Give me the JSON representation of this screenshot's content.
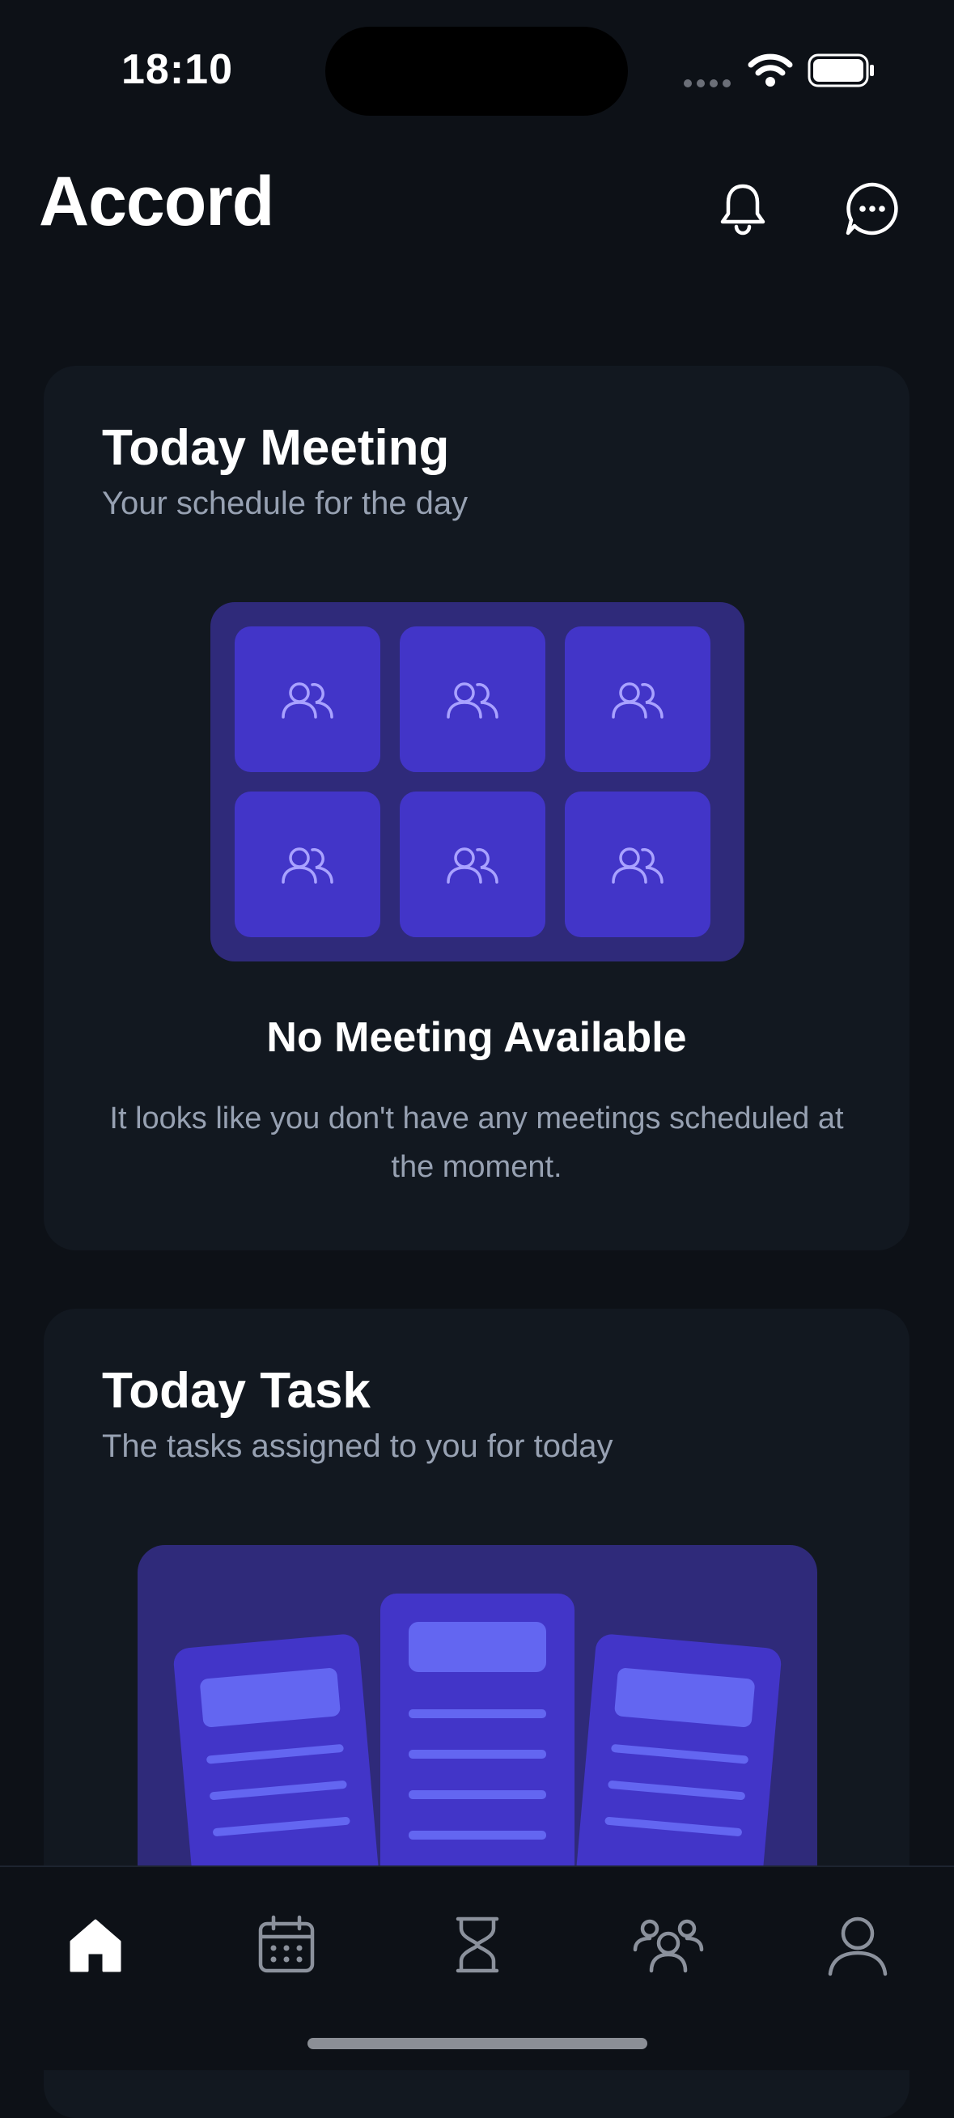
{
  "status_bar": {
    "time": "18:10"
  },
  "header": {
    "title": "Accord",
    "icons": [
      "bell-icon",
      "chat-icon"
    ]
  },
  "meeting_card": {
    "title": "Today Meeting",
    "subtitle": "Your schedule for the day",
    "empty_title": "No Meeting Available",
    "empty_description": "It looks like you don't have any meetings scheduled at the moment."
  },
  "task_card": {
    "title": "Today Task",
    "subtitle": "The tasks assigned to you for today"
  },
  "tab_bar": {
    "items": [
      {
        "name": "home",
        "icon": "home-icon",
        "active": true
      },
      {
        "name": "calendar",
        "icon": "calendar-icon",
        "active": false
      },
      {
        "name": "timer",
        "icon": "hourglass-icon",
        "active": false
      },
      {
        "name": "team",
        "icon": "team-icon",
        "active": false
      },
      {
        "name": "profile",
        "icon": "profile-icon",
        "active": false
      }
    ]
  },
  "colors": {
    "background": "#0d1117",
    "card": "#121820",
    "accent": "#4235c8",
    "accent_dark": "#2f2a7a",
    "accent_light": "#6366f1",
    "muted_text": "#97a1b2"
  }
}
